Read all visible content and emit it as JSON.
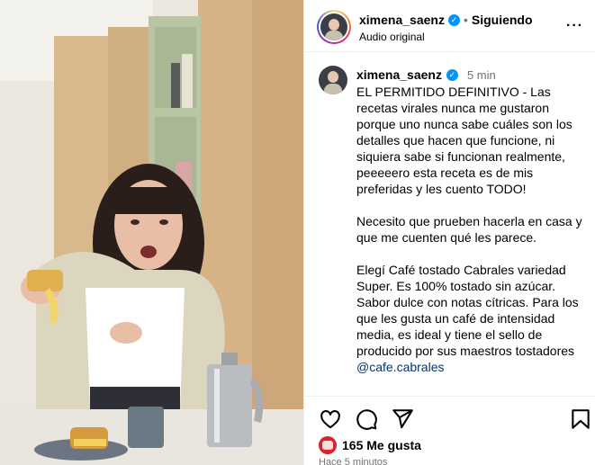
{
  "header": {
    "username": "ximena_saenz",
    "separator": "•",
    "follow_status": "Siguiendo",
    "audio": "Audio original",
    "more": "···"
  },
  "caption": {
    "username": "ximena_saenz",
    "time": "5 min",
    "paragraphs": [
      "EL PERMITIDO DEFINITIVO - Las recetas virales nunca me gustaron porque uno nunca sabe cuáles son los detalles que hacen que funcione, ni siquiera sabe si funcionan realmente, peeeeero esta receta es de mis preferidas y les cuento TODO!",
      "Necesito que prueben hacerla en casa y que me cuenten qué les parece.",
      "Elegí Café tostado Cabrales variedad Super. Es 100% tostado sin azúcar. Sabor dulce con notas cítricas. Para los que les gusta un café de intensidad media, es ideal y tiene el sello de producido por sus maestros tostadores"
    ],
    "mention": "@cafe.cabrales"
  },
  "likes": {
    "text": "165 Me gusta"
  },
  "posted": {
    "text": "Hace 5 minutos"
  },
  "icons": {
    "verified": "verified-badge-icon",
    "like": "heart-icon",
    "comment": "comment-icon",
    "share": "paper-plane-icon",
    "save": "bookmark-icon"
  },
  "colors": {
    "verified": "#0095f6",
    "mention": "#00376b",
    "secondary_text": "#737373"
  }
}
